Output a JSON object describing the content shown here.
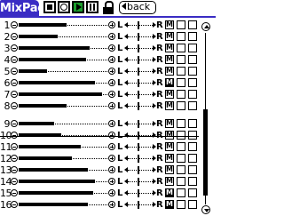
{
  "app": {
    "title": "MixPad",
    "back_label": "back",
    "colors": {
      "title_bar": "#3a2cc4",
      "play_active": "#1a9c2c"
    }
  },
  "transport": {
    "stop_icon": "stop-icon",
    "record_icon": "record-icon",
    "play_icon": "play-icon",
    "play_active": true,
    "pause_icon": "pause-icon",
    "lock_icon": "lock-icon"
  },
  "tracks": [
    {
      "number": "1",
      "volume": 0.54,
      "pan_left": "L",
      "pan_right": "R",
      "mute_label": "M",
      "muted": false
    },
    {
      "number": "2",
      "volume": 0.44,
      "pan_left": "L",
      "pan_right": "R",
      "mute_label": "M",
      "muted": false
    },
    {
      "number": "3",
      "volume": 0.8,
      "pan_left": "L",
      "pan_right": "R",
      "mute_label": "M",
      "muted": false
    },
    {
      "number": "4",
      "volume": 0.76,
      "pan_left": "L",
      "pan_right": "R",
      "mute_label": "M",
      "muted": false
    },
    {
      "number": "5",
      "volume": 0.32,
      "pan_left": "L",
      "pan_right": "R",
      "mute_label": "M",
      "muted": false
    },
    {
      "number": "6",
      "volume": 0.86,
      "pan_left": "L",
      "pan_right": "R",
      "mute_label": "M",
      "muted": true
    },
    {
      "number": "7",
      "volume": 0.94,
      "pan_left": "L",
      "pan_right": "R",
      "mute_label": "M",
      "muted": false
    },
    {
      "number": "8",
      "volume": 0.54,
      "pan_left": "L",
      "pan_right": "R",
      "mute_label": "M",
      "muted": false
    },
    {
      "number": "9",
      "volume": 0.4,
      "pan_left": "L",
      "pan_right": "R",
      "mute_label": "M",
      "muted": false
    },
    {
      "number": "10",
      "volume": 0.48,
      "pan_left": "L",
      "pan_right": "R",
      "mute_label": "M",
      "muted": false
    },
    {
      "number": "11",
      "volume": 0.7,
      "pan_left": "L",
      "pan_right": "R",
      "mute_label": "M",
      "muted": false
    },
    {
      "number": "12",
      "volume": 0.6,
      "pan_left": "L",
      "pan_right": "R",
      "mute_label": "M",
      "muted": false
    },
    {
      "number": "13",
      "volume": 0.78,
      "pan_left": "L",
      "pan_right": "R",
      "mute_label": "M",
      "muted": false
    },
    {
      "number": "14",
      "volume": 0.86,
      "pan_left": "L",
      "pan_right": "R",
      "mute_label": "M",
      "muted": false
    },
    {
      "number": "15",
      "volume": 0.84,
      "pan_left": "L",
      "pan_right": "R",
      "mute_label": "M",
      "muted": true
    },
    {
      "number": "16",
      "volume": 0.78,
      "pan_left": "L",
      "pan_right": "R",
      "mute_label": "M",
      "muted": true
    }
  ],
  "scrollbar": {
    "position": 0.45,
    "visible_fraction": 0.5
  }
}
